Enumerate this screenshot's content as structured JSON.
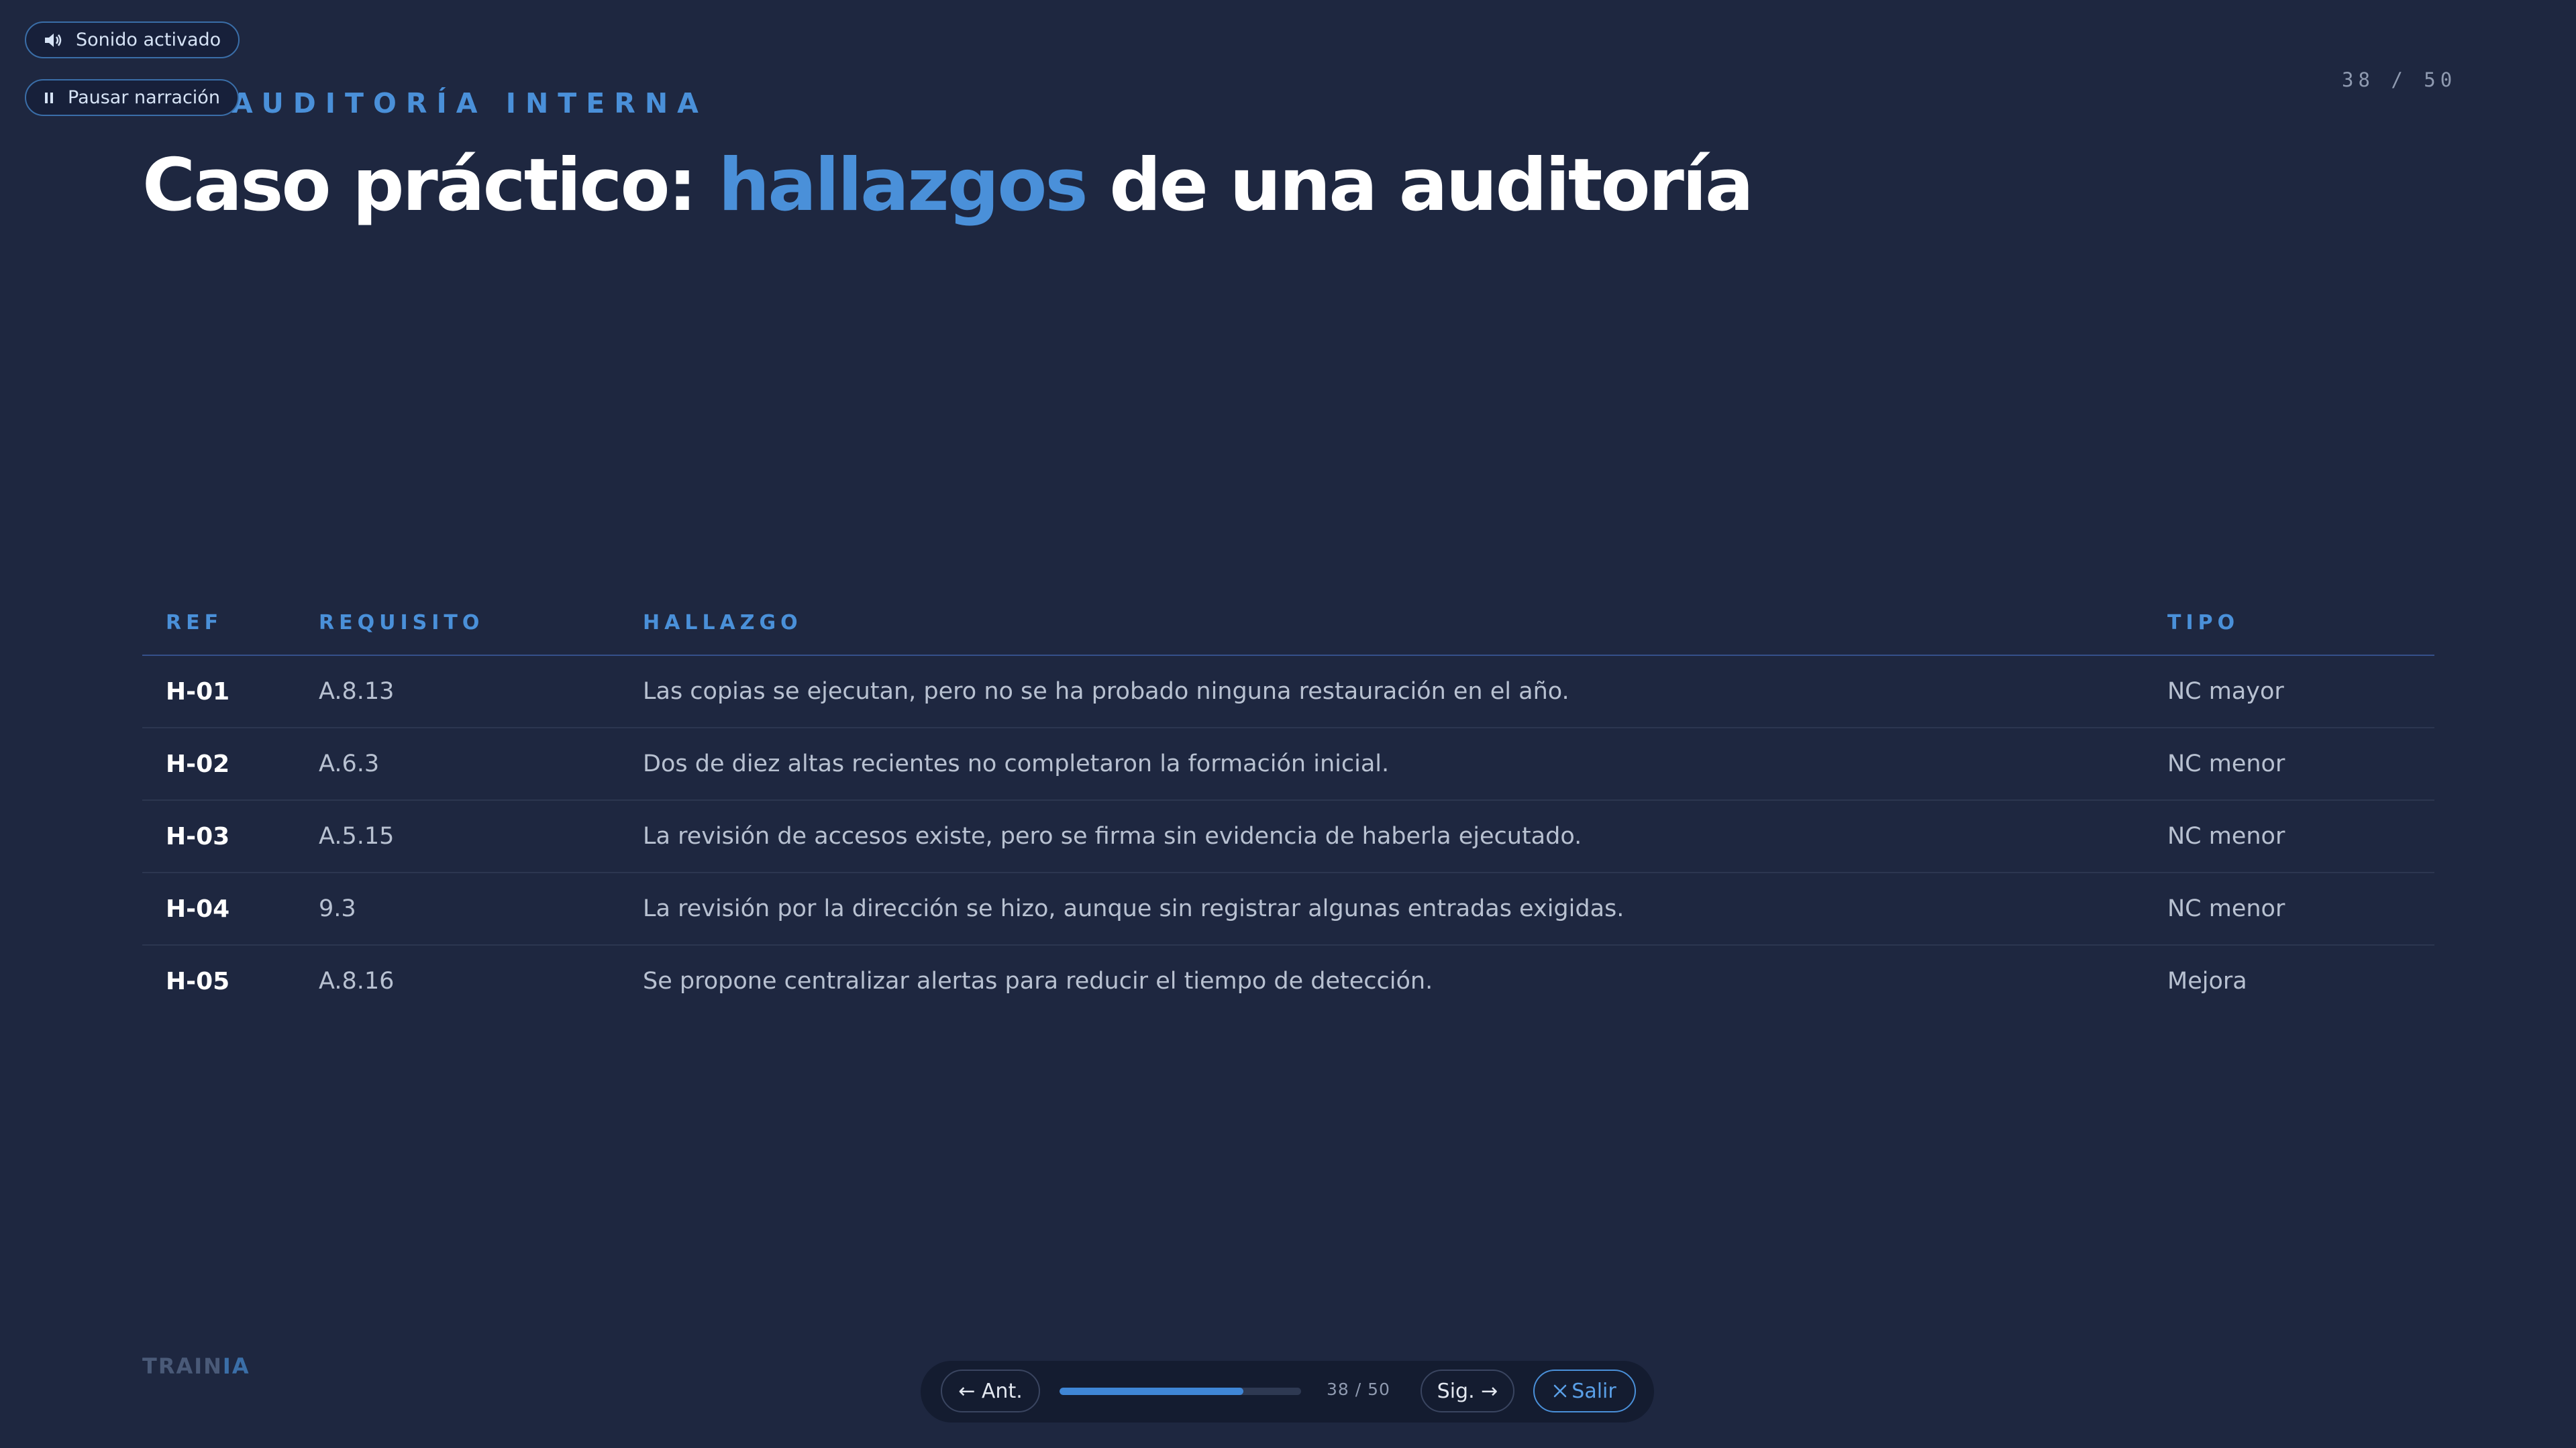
{
  "controls": {
    "sound_label": "Sonido activado",
    "pause_label": "Pausar narración"
  },
  "header": {
    "eyebrow": "AUDITORÍA INTERNA",
    "counter": "38 / 50"
  },
  "title": {
    "part1": "Caso práctico: ",
    "highlight": "hallazgos",
    "part2": " de una auditoría"
  },
  "table": {
    "headers": [
      "REF",
      "REQUISITO",
      "HALLAZGO",
      "TIPO"
    ],
    "rows": [
      {
        "ref": "H-01",
        "req": "A.8.13",
        "hallazgo": "Las copias se ejecutan, pero no se ha probado ninguna restauración en el año.",
        "tipo": "NC mayor"
      },
      {
        "ref": "H-02",
        "req": "A.6.3",
        "hallazgo": "Dos de diez altas recientes no completaron la formación inicial.",
        "tipo": "NC menor"
      },
      {
        "ref": "H-03",
        "req": "A.5.15",
        "hallazgo": "La revisión de accesos existe, pero se firma sin evidencia de haberla ejecutado.",
        "tipo": "NC menor"
      },
      {
        "ref": "H-04",
        "req": "9.3",
        "hallazgo": "La revisión por la dirección se hizo, aunque sin registrar algunas entradas exigidas.",
        "tipo": "NC menor"
      },
      {
        "ref": "H-05",
        "req": "A.8.16",
        "hallazgo": "Se propone centralizar alertas para reducir el tiempo de detección.",
        "tipo": "Mejora"
      }
    ]
  },
  "brand": {
    "main": "TRAIN",
    "accent": "IA"
  },
  "nav": {
    "prev_label": "← Ant.",
    "next_label": "Sig. →",
    "exit_label": "Salir",
    "counter": "38 / 50",
    "progress": 0.76
  },
  "colors": {
    "background": "#1e2740",
    "accent": "#4a90d9",
    "text": "#ffffff",
    "muted": "#b8c1d1"
  },
  "icons": {
    "sound": "speaker-icon",
    "pause": "pause-icon",
    "exit": "close-icon"
  }
}
